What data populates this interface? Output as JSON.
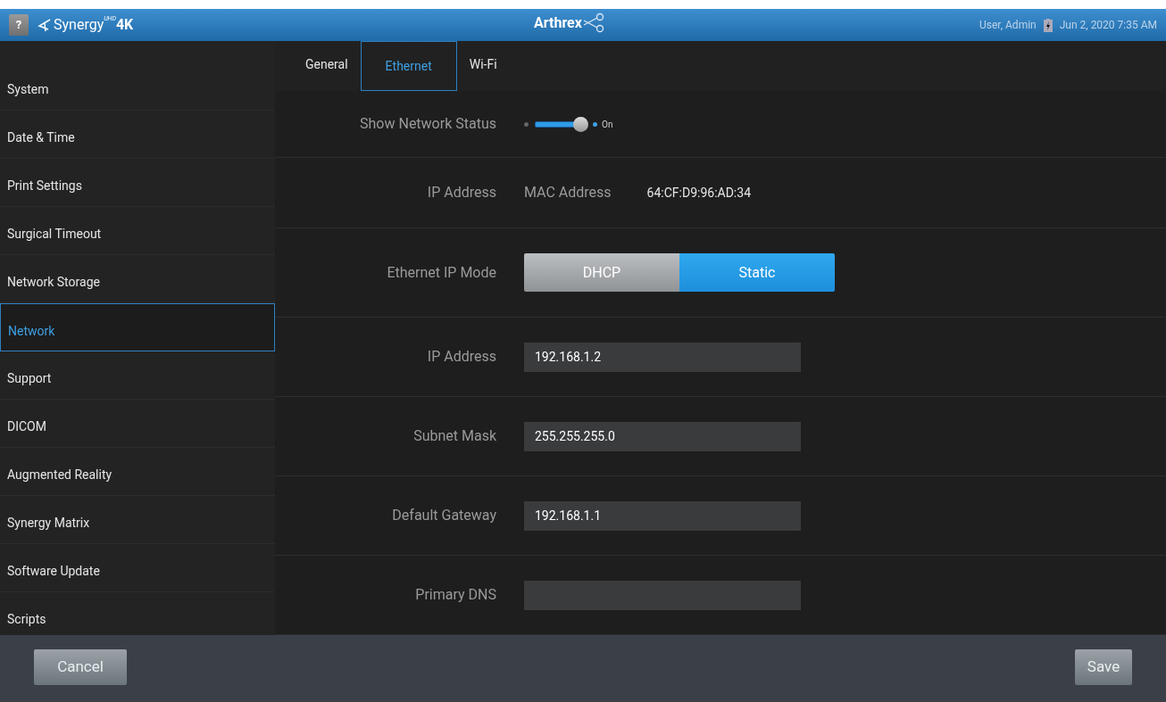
{
  "header": {
    "help": "?",
    "product": "Synergy",
    "product_sup": "UHD",
    "product_suffix": "4K",
    "brand": "Arthrex",
    "user": "User, Admin",
    "datetime": "Jun 2, 2020 7:35 AM"
  },
  "sidebar": {
    "items": [
      {
        "label": "System",
        "selected": false
      },
      {
        "label": "Date & Time",
        "selected": false
      },
      {
        "label": "Print Settings",
        "selected": false
      },
      {
        "label": "Surgical Timeout",
        "selected": false
      },
      {
        "label": "Network Storage",
        "selected": false
      },
      {
        "label": "Network",
        "selected": true
      },
      {
        "label": "Support",
        "selected": false
      },
      {
        "label": "DICOM",
        "selected": false
      },
      {
        "label": "Augmented Reality",
        "selected": false
      },
      {
        "label": "Synergy Matrix",
        "selected": false
      },
      {
        "label": "Software Update",
        "selected": false
      },
      {
        "label": "Scripts",
        "selected": false
      }
    ]
  },
  "tabs": [
    {
      "label": "General",
      "selected": false
    },
    {
      "label": "Ethernet",
      "selected": true
    },
    {
      "label": "Wi-Fi",
      "selected": false
    }
  ],
  "settings": [
    {
      "kind": "toggle",
      "label": "Show Network Status",
      "on": true,
      "state_text": "On"
    },
    {
      "kind": "info",
      "label": "IP Address",
      "sublabel": "MAC Address",
      "value": "64:CF:D9:96:AD:34"
    },
    {
      "kind": "segmented",
      "label": "Ethernet IP Mode",
      "options": [
        {
          "label": "DHCP",
          "selected": false
        },
        {
          "label": "Static",
          "selected": true
        }
      ]
    },
    {
      "kind": "field",
      "label": "IP Address",
      "value": "192.168.1.2"
    },
    {
      "kind": "field",
      "label": "Subnet Mask",
      "value": "255.255.255.0"
    },
    {
      "kind": "field",
      "label": "Default Gateway",
      "value": "192.168.1.1"
    },
    {
      "kind": "field",
      "label": "Primary DNS"
    }
  ],
  "footer": {
    "cancel": "Cancel",
    "save": "Save"
  }
}
